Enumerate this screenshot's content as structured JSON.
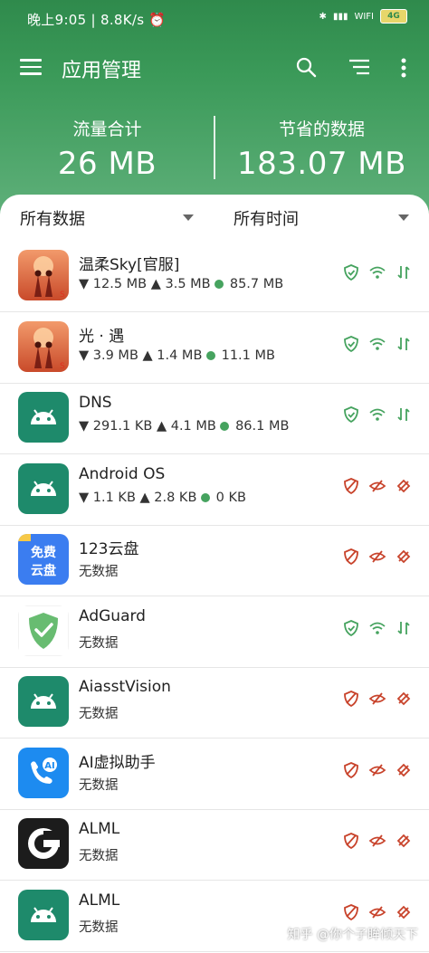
{
  "status_bar": {
    "time": "晚上9:05",
    "speed": "8.8K/s",
    "network": "4G"
  },
  "toolbar": {
    "title": "应用管理"
  },
  "summary": {
    "total_label": "流量合计",
    "total_value": "26 MB",
    "saved_label": "节省的数据",
    "saved_value": "183.07 MB"
  },
  "filters": {
    "data_filter": "所有数据",
    "time_filter": "所有时间"
  },
  "colors": {
    "brand_green": "#3b9a59",
    "allowed_green": "#46a35f",
    "blocked_red": "#c8432b"
  },
  "apps": [
    {
      "name": "温柔Sky[官服]",
      "down": "▼ 12.5 MB",
      "up": "▲ 3.5 MB",
      "saved": "85.7 MB",
      "status": "allowed",
      "icon": "sky-game-icon"
    },
    {
      "name": "光 · 遇",
      "down": "▼ 3.9 MB",
      "up": "▲ 1.4 MB",
      "saved": "11.1 MB",
      "status": "allowed",
      "icon": "sky-game-icon"
    },
    {
      "name": "DNS",
      "down": "▼ 291.1 KB",
      "up": "▲ 4.1 MB",
      "saved": "86.1 MB",
      "status": "allowed",
      "icon": "android-icon"
    },
    {
      "name": "Android OS",
      "down": "▼ 1.1 KB",
      "up": "▲ 2.8 KB",
      "saved": "0 KB",
      "status": "blocked",
      "icon": "android-icon"
    },
    {
      "name": "123云盘",
      "nodata": "无数据",
      "status": "blocked",
      "icon": "cloud-disk-icon",
      "icon_text_1": "免费",
      "icon_text_2": "云盘"
    },
    {
      "name": "AdGuard",
      "nodata": "无数据",
      "status": "allowed",
      "icon": "adguard-shield-icon"
    },
    {
      "name": "AiasstVision",
      "nodata": "无数据",
      "status": "blocked",
      "icon": "android-icon"
    },
    {
      "name": "AI虚拟助手",
      "nodata": "无数据",
      "status": "blocked",
      "icon": "ai-phone-icon",
      "icon_text": "AI"
    },
    {
      "name": "ALML",
      "nodata": "无数据",
      "status": "blocked",
      "icon": "g-logo-icon"
    },
    {
      "name": "ALML",
      "nodata": "无数据",
      "status": "blocked",
      "icon": "android-icon"
    }
  ],
  "watermark": "知乎 @你个子眸倾天下"
}
